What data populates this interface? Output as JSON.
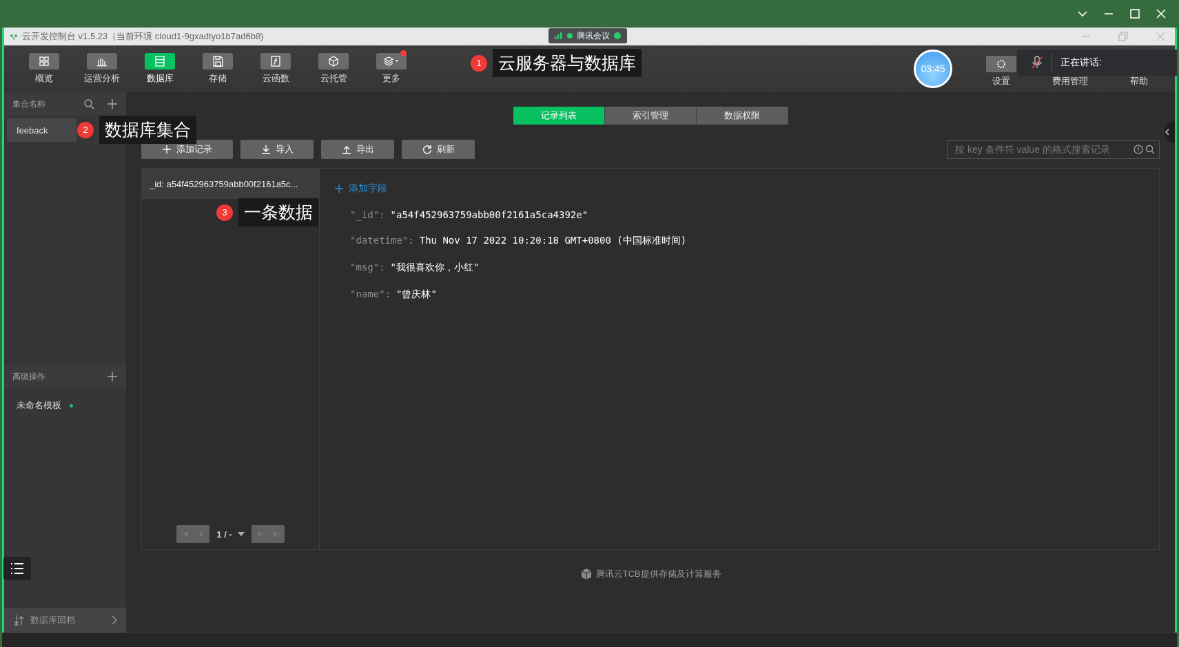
{
  "window": {
    "title": "云开发控制台 v1.5.23（当前环境 cloud1-9gxadtyo1b7ad6b8)"
  },
  "meeting_pill": {
    "label": "腾讯会议"
  },
  "toolbar": {
    "items": [
      {
        "label": "概览",
        "kind": "grid",
        "selected": false,
        "notification_dot": false
      },
      {
        "label": "运营分析",
        "kind": "bars",
        "selected": false,
        "notification_dot": false
      },
      {
        "label": "数据库",
        "kind": "table",
        "selected": true,
        "notification_dot": false
      },
      {
        "label": "存储",
        "kind": "disk",
        "selected": false,
        "notification_dot": false
      },
      {
        "label": "云函数",
        "kind": "function",
        "selected": false,
        "notification_dot": false
      },
      {
        "label": "云托管",
        "kind": "cube",
        "selected": false,
        "notification_dot": false
      },
      {
        "label": "更多",
        "kind": "layers",
        "selected": false,
        "notification_dot": true
      }
    ],
    "annotation": {
      "number": "1",
      "text": "云服务器与数据库"
    },
    "timer": "03:45",
    "right_items": [
      {
        "label": "设置"
      },
      {
        "label": "费用管理"
      },
      {
        "label": "帮助"
      }
    ]
  },
  "speaking_overlay": {
    "label": "正在讲话:",
    "muted": true
  },
  "sidebar": {
    "collections_header": "集合名称",
    "collections": [
      {
        "name": "feeback",
        "selected": true
      }
    ],
    "annotation": {
      "number": "2",
      "text": "数据库集合"
    },
    "advanced_header": "高级操作",
    "templates": [
      {
        "name": "未命名模板",
        "color": "#19c16a"
      }
    ],
    "rollback": "数据库回档"
  },
  "main": {
    "tabs": [
      {
        "label": "记录列表",
        "selected": true
      },
      {
        "label": "索引管理",
        "selected": false
      },
      {
        "label": "数据权限",
        "selected": false
      }
    ],
    "buttons": [
      {
        "label": "添加记录",
        "kind": "add"
      },
      {
        "label": "导入",
        "kind": "import"
      },
      {
        "label": "导出",
        "kind": "export"
      },
      {
        "label": "刷新",
        "kind": "refresh"
      }
    ],
    "search": {
      "placeholder": "按 key 条件符 value 的格式搜索记录"
    },
    "records": [
      {
        "label": "_id: a54f452963759abb00f2161a5c...",
        "selected": true
      }
    ],
    "annotation": {
      "number": "3",
      "text": "一条数据"
    },
    "pagination": {
      "page": "1 / -"
    },
    "add_field": "添加字段",
    "fields": [
      {
        "key": "\"_id\":",
        "value": "\"a54f452963759abb00f2161a5ca4392e\""
      },
      {
        "key": "\"datetime\":",
        "value": "Thu Nov 17 2022 10:20:18 GMT+0800 (中国标准时间)"
      },
      {
        "key": "\"msg\":",
        "value": "\"我很喜欢你，小红\""
      },
      {
        "key": "\"name\":",
        "value": "\"曾庆林\""
      }
    ],
    "footer": "腾讯云TCB提供存储及计算服务"
  }
}
